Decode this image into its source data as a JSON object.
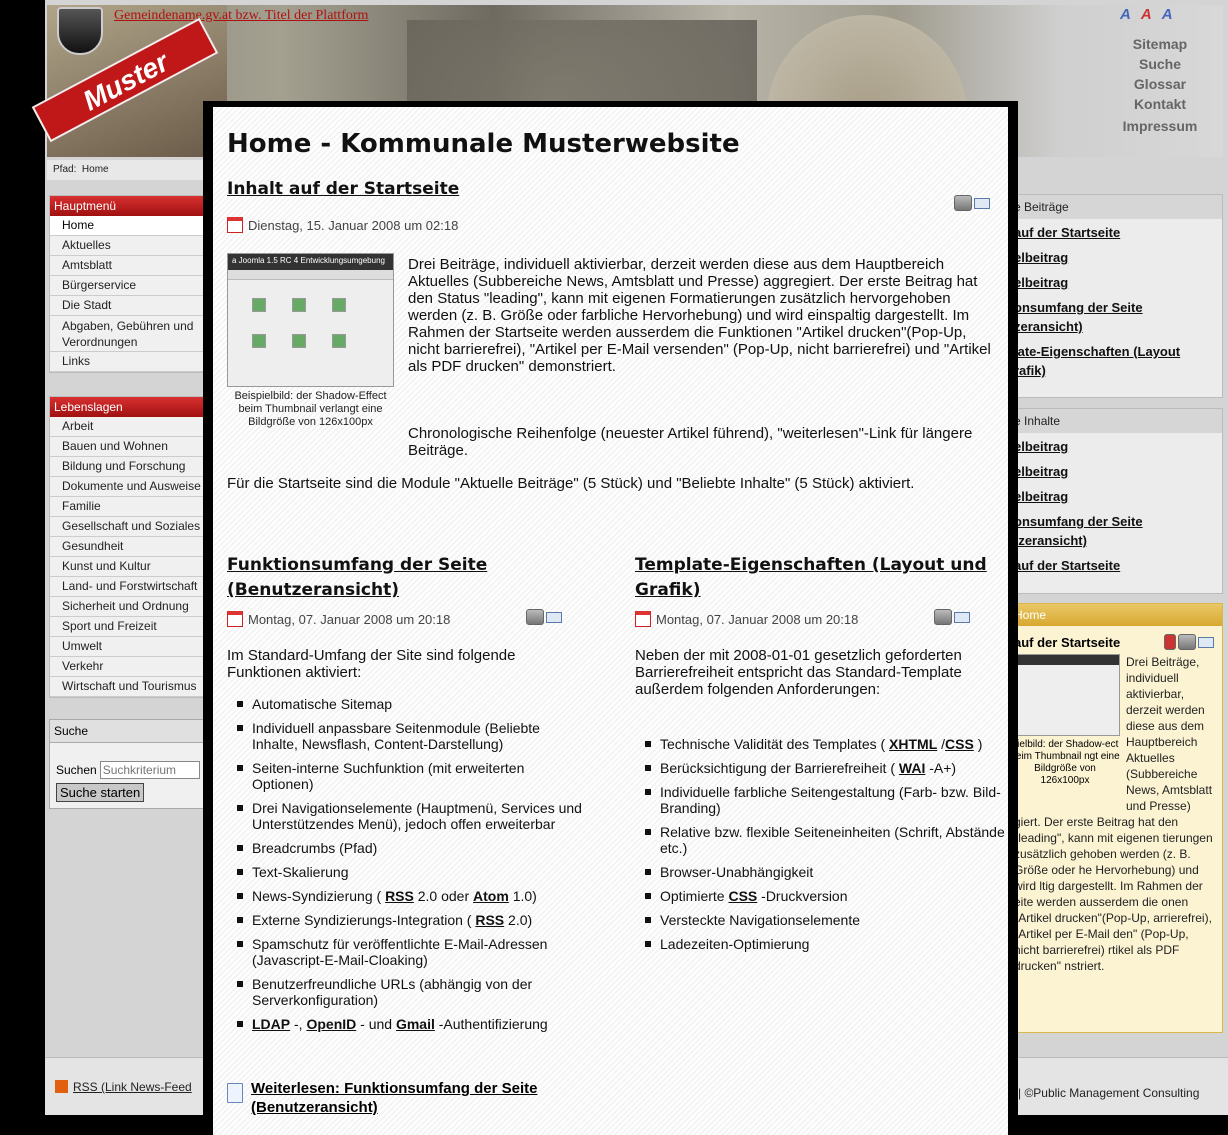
{
  "header": {
    "site_title": "Gemeindename.gv.at bzw. Titel der Plattform",
    "badge": "Muster",
    "font_sizes": [
      "A",
      "A",
      "A"
    ],
    "utility_links": [
      "Sitemap",
      "Suche",
      "Glossar",
      "Kontakt",
      "Impressum"
    ]
  },
  "path": {
    "label": "Pfad:",
    "current": "Home"
  },
  "main_menu": {
    "title": "Hauptmenü",
    "items": [
      "Home",
      "Aktuelles",
      "Amtsblatt",
      "Bürgerservice",
      "Die Stadt",
      "Abgaben, Gebühren und Verordnungen",
      "Links"
    ]
  },
  "lebenslagen": {
    "title": "Lebenslagen",
    "items": [
      "Arbeit",
      "Bauen und Wohnen",
      "Bildung und Forschung",
      "Dokumente und Ausweise",
      "Familie",
      "Gesellschaft und Soziales",
      "Gesundheit",
      "Kunst und Kultur",
      "Land- und Forstwirtschaft",
      "Sicherheit und Ordnung",
      "Sport und Freizeit",
      "Umwelt",
      "Verkehr",
      "Wirtschaft und Tourismus"
    ]
  },
  "search": {
    "title": "Suche",
    "label": "Suchen",
    "placeholder": "Suchkriterium",
    "button": "Suche starten"
  },
  "right": {
    "box1": {
      "title": "e Beiträge",
      "links": [
        "auf der Startseite",
        "elbeitrag",
        "elbeitrag",
        "onsumfang der Seite zeransicht)",
        "late-Eigenschaften (Layout rafik)"
      ]
    },
    "box2": {
      "title": "e Inhalte",
      "links": [
        "elbeitrag",
        "elbeitrag",
        "elbeitrag",
        "onsumfang der Seite tzeransicht)",
        "auf der Startseite"
      ]
    },
    "home_box": {
      "title": "Home",
      "article_title": "auf der Startseite",
      "text": "Drei Beiträge, individuell aktivierbar, derzeit werden diese aus dem Hauptbereich Aktuelles (Subbereiche News, Amtsblatt und Presse)",
      "caption": "pielbild: der Shadow-ect beim Thumbnail ngt eine Bildgröße von 126x100px",
      "text2": "giert. Der erste Beitrag hat den \"leading\", kann mit eigenen tierungen zusätzlich gehoben werden (z. B. Größe oder he Hervorhebung) und wird ltig dargestellt. Im Rahmen der eite werden ausserdem die onen \"Artikel drucken\"(Pop-Up, arrierefrei), \"Artikel per E-Mail den\" (Pop-Up, nicht barrierefrei) rtikel als PDF drucken\" nstriert."
    }
  },
  "footer": {
    "rss": "RSS (Link News-Feed",
    "copyright": "| ©Public Management Consulting"
  },
  "overlay": {
    "title": "Home - Kommunale Musterwebsite",
    "lead": {
      "title": "Inhalt auf der Startseite",
      "date": "Dienstag, 15. Januar 2008 um 02:18",
      "thumb_bar": "a Joomla 1.5 RC 4 Entwicklungsumgebung",
      "thumb_caption": "Beispielbild: der Shadow-Effect beim Thumbnail verlangt eine Bildgröße von 126x100px",
      "p1": "Drei Beiträge, individuell aktivierbar, derzeit werden diese aus dem Hauptbereich Aktuelles (Subbereiche News, Amtsblatt und Presse) aggregiert. Der erste Beitrag hat den Status \"leading\", kann mit eigenen Formatierungen zusätzlich hervorgehoben werden (z. B. Größe oder farbliche Hervorhebung) und wird einspaltig dargestellt. Im Rahmen der Startseite werden ausserdem die Funktionen \"Artikel drucken\"(Pop-Up, nicht barrierefrei), \"Artikel per E-Mail versenden\" (Pop-Up, nicht barrierefrei) und \"Artikel als PDF drucken\" demonstriert.",
      "p2": "Chronologische Reihenfolge (neuester Artikel führend), \"weiterlesen\"-Link für längere Beiträge.",
      "p3": "Für die Startseite sind die Module \"Aktuelle Beiträge\" (5 Stück) und \"Beliebte Inhalte\" (5 Stück) aktiviert."
    },
    "left_article": {
      "title": "Funktionsumfang der Seite (Benutzeransicht)",
      "date": "Montag, 07. Januar 2008 um 20:18",
      "intro": "Im Standard-Umfang der Site sind folgende Funktionen aktiviert:",
      "items": [
        "Automatische Sitemap",
        "Individuell anpassbare Seitenmodule (Beliebte Inhalte, Newsflash, Content-Darstellung)",
        "Seiten-interne Suchfunktion (mit erweiterten Optionen)",
        "Drei Navigationselemente (Hauptmenü, Services und Unterstützendes Menü), jedoch offen erweiterbar",
        "Breadcrumbs (Pfad)",
        "Text-Skalierung"
      ],
      "rss1": {
        "a": "News-Syndizierung (",
        "b": "RSS",
        "c": "2.0 oder",
        "d": "Atom",
        "e": "1.0)"
      },
      "rss2": {
        "a": "Externe Syndizierungs-Integration (",
        "b": "RSS",
        "c": "2.0)"
      },
      "items2": [
        "Spamschutz für veröffentlichte E-Mail-Adressen (Javascript-E-Mail-Cloaking)",
        "Benutzerfreundliche URLs (abhängig von der Serverkonfiguration)"
      ],
      "auth": {
        "a": "LDAP",
        "b": "-,",
        "c": "OpenID",
        "d": "- und",
        "e": "Gmail",
        "f": "-Authentifizierung"
      },
      "readmore": "Weiterlesen: Funktionsumfang der Seite (Benutzeransicht)"
    },
    "right_article": {
      "title": "Template-Eigenschaften (Layout und Grafik)",
      "date": "Montag, 07. Januar 2008 um 20:18",
      "intro": "Neben der mit 2008-01-01 gesetzlich geforderten Barrierefreiheit entspricht das Standard-Template außerdem folgenden Anforderungen:",
      "valid": {
        "a": "Technische Validität des Templates (",
        "b": "XHTML",
        "c": "/",
        "d": "CSS",
        "e": ")"
      },
      "wai": {
        "a": "Berücksichtigung der Barrierefreiheit (",
        "b": "WAI",
        "c": "-A+)"
      },
      "items": [
        "Individuelle farbliche Seitengestaltung (Farb- bzw. Bild-Branding)",
        "Relative bzw. flexible Seiteneinheiten (Schrift, Abstände etc.)",
        "Browser-Unabhängigkeit"
      ],
      "css": {
        "a": "Optimierte",
        "b": "CSS",
        "c": "-Druckversion"
      },
      "items2": [
        "Versteckte Navigationselemente",
        "Ladezeiten-Optimierung"
      ]
    }
  }
}
